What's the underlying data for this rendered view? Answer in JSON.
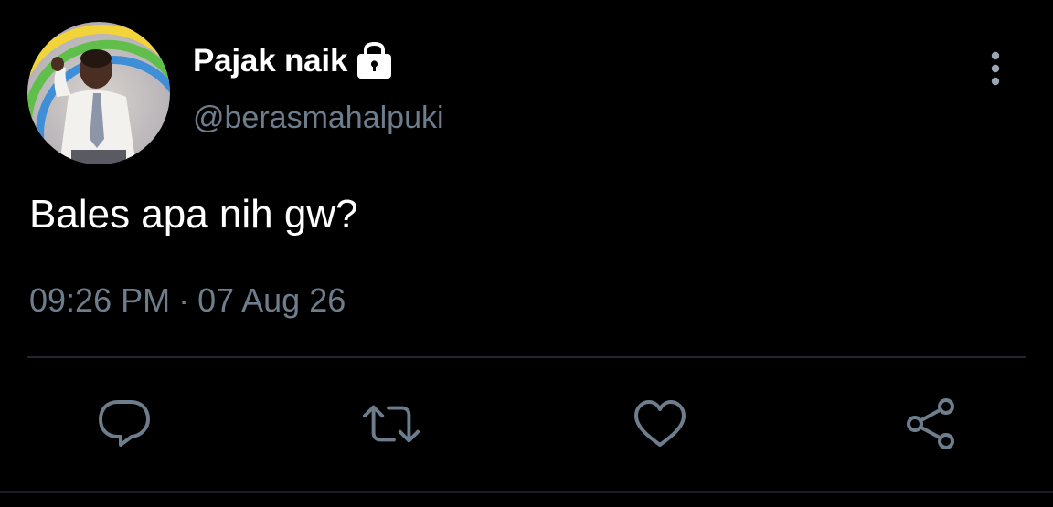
{
  "tweet": {
    "display_name": "Pajak naik",
    "handle": "@berasmahalpuki",
    "text": "Bales apa nih gw?",
    "time": "09:26 PM",
    "separator": "·",
    "date": "07 Aug 26"
  },
  "icons": {
    "verified_lock": "lock-icon",
    "more": "vertical-dots-icon",
    "reply": "reply-bubble-icon",
    "retweet": "retweet-icon",
    "like": "heart-icon",
    "share": "share-icon"
  },
  "colors": {
    "background": "#000000",
    "primary_text": "#ffffff",
    "secondary_text": "#6e7d8c",
    "icon": "#6e7d8c",
    "divider": "#22272e"
  }
}
